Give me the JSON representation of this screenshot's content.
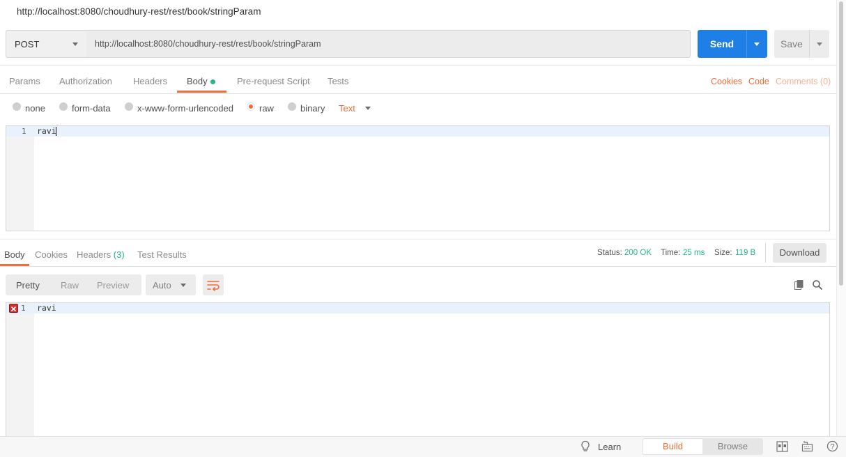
{
  "title": "http://localhost:8080/choudhury-rest/rest/book/stringParam",
  "request": {
    "method": "POST",
    "url": "http://localhost:8080/choudhury-rest/rest/book/stringParam",
    "send_label": "Send",
    "save_label": "Save"
  },
  "request_tabs": [
    "Params",
    "Authorization",
    "Headers",
    "Body",
    "Pre-request Script",
    "Tests"
  ],
  "request_links": {
    "cookies": "Cookies",
    "code": "Code",
    "comments": "Comments (0)"
  },
  "body_types": {
    "options": [
      "none",
      "form-data",
      "x-www-form-urlencoded",
      "raw",
      "binary"
    ],
    "selected": "raw",
    "format": "Text"
  },
  "request_body": {
    "line_number": "1",
    "text": "ravi"
  },
  "response_tabs": {
    "body": "Body",
    "cookies": "Cookies",
    "headers": "Headers",
    "headers_count": "(3)",
    "test_results": "Test Results"
  },
  "response_meta": {
    "status_label": "Status:",
    "status_value": "200 OK",
    "time_label": "Time:",
    "time_value": "25 ms",
    "size_label": "Size:",
    "size_value": "119 B",
    "download_label": "Download"
  },
  "response_view": {
    "modes": [
      "Pretty",
      "Raw",
      "Preview"
    ],
    "selected": "Pretty",
    "format": "Auto"
  },
  "response_body": {
    "line_number": "1",
    "text": "ravi"
  },
  "footer": {
    "learn": "Learn",
    "build": "Build",
    "browse": "Browse"
  },
  "colors": {
    "accent": "#f26b3a",
    "primary": "#1e7fe6",
    "success": "#26b47f"
  }
}
